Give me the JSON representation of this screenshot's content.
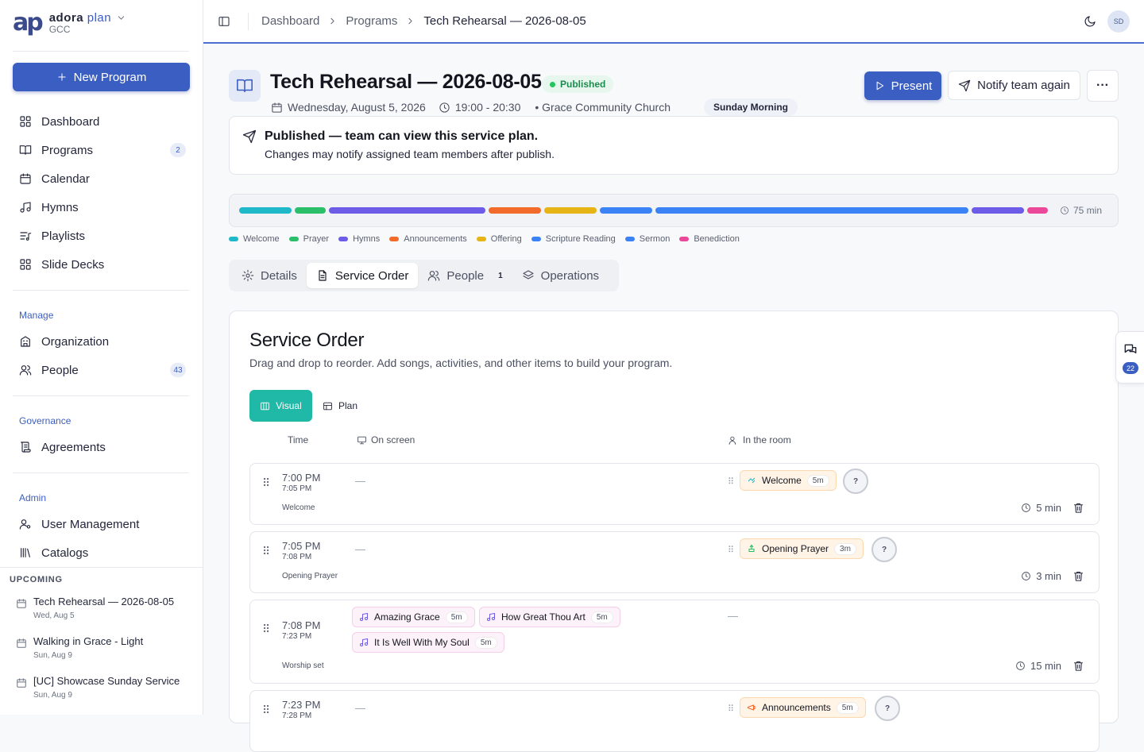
{
  "brand": {
    "logo": "ap",
    "name_a": "adora",
    "name_b": "plan",
    "org": "GCC"
  },
  "sidebar": {
    "new_program": "New Program",
    "main": [
      {
        "label": "Dashboard",
        "icon": "grid-icon"
      },
      {
        "label": "Programs",
        "icon": "book-icon",
        "badge": "2"
      },
      {
        "label": "Calendar",
        "icon": "calendar-icon"
      },
      {
        "label": "Hymns",
        "icon": "music-icon"
      },
      {
        "label": "Playlists",
        "icon": "playlist-icon"
      },
      {
        "label": "Slide Decks",
        "icon": "grid-icon"
      }
    ],
    "manage_title": "Manage",
    "manage": [
      {
        "label": "Organization",
        "icon": "building-icon"
      },
      {
        "label": "People",
        "icon": "users-icon",
        "badge": "43"
      }
    ],
    "governance_title": "Governance",
    "governance": [
      {
        "label": "Agreements",
        "icon": "scroll-icon"
      }
    ],
    "admin_title": "Admin",
    "admin": [
      {
        "label": "User Management",
        "icon": "user-key-icon"
      },
      {
        "label": "Catalogs",
        "icon": "library-icon"
      }
    ],
    "upcoming_title": "UPCOMING",
    "upcoming": [
      {
        "title": "Tech Rehearsal — 2026-08-05",
        "date": "Wed, Aug 5"
      },
      {
        "title": "Walking in Grace - Light",
        "date": "Sun, Aug 9"
      },
      {
        "title": "[UC] Showcase Sunday Service",
        "date": "Sun, Aug 9"
      }
    ]
  },
  "topbar": {
    "breadcrumbs": [
      "Dashboard",
      "Programs",
      "Tech Rehearsal — 2026-08-05"
    ],
    "avatar": "SD"
  },
  "header": {
    "title": "Tech Rehearsal — 2026-08-05",
    "status": "Published",
    "date": "Wednesday, August 5, 2026",
    "time": "19:00 - 20:30",
    "location": "• Grace Community Church",
    "service_tag": "Sunday Morning",
    "present": "Present",
    "notify": "Notify team again",
    "more": "···"
  },
  "notice": {
    "title": "Published — team can view this service plan.",
    "subtitle": "Changes may notify assigned team members after publish."
  },
  "timeline": {
    "total": "75 min",
    "segments": [
      {
        "type": "Welcome",
        "minutes": 5,
        "color": "#1fb8c9"
      },
      {
        "type": "Prayer",
        "minutes": 3,
        "color": "#2bbf6a"
      },
      {
        "type": "Hymns",
        "minutes": 15,
        "color": "#6c5ce7"
      },
      {
        "type": "Announcements",
        "minutes": 5,
        "color": "#f26b2a"
      },
      {
        "type": "Offering",
        "minutes": 5,
        "color": "#e7b416"
      },
      {
        "type": "Scripture Reading",
        "minutes": 5,
        "color": "#3b82f6"
      },
      {
        "type": "Sermon",
        "minutes": 30,
        "color": "#3b82f6"
      },
      {
        "type": "Hymns",
        "minutes": 5,
        "color": "#6c5ce7"
      },
      {
        "type": "Benediction",
        "minutes": 2,
        "color": "#ec4899"
      }
    ],
    "legend": [
      {
        "label": "Welcome",
        "color": "#1fb8c9"
      },
      {
        "label": "Prayer",
        "color": "#2bbf6a"
      },
      {
        "label": "Hymns",
        "color": "#6c5ce7"
      },
      {
        "label": "Announcements",
        "color": "#f26b2a"
      },
      {
        "label": "Offering",
        "color": "#e7b416"
      },
      {
        "label": "Scripture Reading",
        "color": "#3b82f6"
      },
      {
        "label": "Sermon",
        "color": "#3b82f6"
      },
      {
        "label": "Benediction",
        "color": "#ec4899"
      }
    ]
  },
  "tabs": [
    {
      "label": "Details",
      "icon": "gear-icon"
    },
    {
      "label": "Service Order",
      "icon": "document-icon",
      "active": true
    },
    {
      "label": "People",
      "icon": "users-icon",
      "count": "1"
    },
    {
      "label": "Operations",
      "icon": "layers-icon"
    }
  ],
  "service_order": {
    "title": "Service Order",
    "subtitle": "Drag and drop to reorder. Add songs, activities, and other items to build your program.",
    "view_visual": "Visual",
    "view_plan": "Plan",
    "col_time": "Time",
    "col_screen": "On screen",
    "col_room": "In the room",
    "rows": [
      {
        "start": "7:00 PM",
        "end": "7:05 PM",
        "name": "Welcome",
        "screen": "—",
        "room": {
          "label": "Welcome",
          "mins": "5m"
        },
        "assignee": "?",
        "duration": "5 min"
      },
      {
        "start": "7:05 PM",
        "end": "7:08 PM",
        "name": "Opening Prayer",
        "screen": "—",
        "room": {
          "label": "Opening Prayer",
          "mins": "3m"
        },
        "assignee": "?",
        "duration": "3 min"
      },
      {
        "start": "7:08 PM",
        "end": "7:23 PM",
        "name": "Worship set",
        "songs": [
          {
            "label": "Amazing Grace",
            "mins": "5m"
          },
          {
            "label": "How Great Thou Art",
            "mins": "5m"
          },
          {
            "label": "It Is Well With My Soul",
            "mins": "5m"
          }
        ],
        "room_empty": "—",
        "duration": "15 min"
      },
      {
        "start": "7:23 PM",
        "end": "7:28 PM",
        "screen": "—",
        "room": {
          "label": "Announcements",
          "mins": "5m"
        },
        "assignee": "?"
      }
    ]
  },
  "comments": {
    "count": "22"
  }
}
